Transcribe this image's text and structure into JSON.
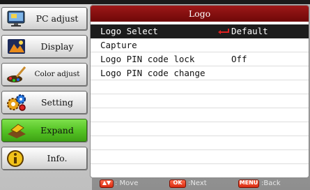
{
  "sidebar": {
    "items": [
      {
        "label": "PC adjust",
        "icon": "monitor-icon",
        "active": false
      },
      {
        "label": "Display",
        "icon": "display-icon",
        "active": false
      },
      {
        "label": "Color adjust",
        "icon": "color-brush-icon",
        "active": false
      },
      {
        "label": "Setting",
        "icon": "gears-icon",
        "active": false
      },
      {
        "label": "Expand",
        "icon": "expand-icon",
        "active": true
      },
      {
        "label": "Info.",
        "icon": "info-icon",
        "active": false
      }
    ]
  },
  "menu": {
    "title": "Logo",
    "rows": [
      {
        "label": "Logo Select",
        "value": "Default",
        "selected": true
      },
      {
        "label": "Capture",
        "value": ""
      },
      {
        "label": "Logo PIN code lock",
        "value": "Off"
      },
      {
        "label": "Logo PIN code change",
        "value": ""
      },
      {
        "label": "",
        "value": ""
      },
      {
        "label": "",
        "value": ""
      },
      {
        "label": "",
        "value": ""
      },
      {
        "label": "",
        "value": ""
      },
      {
        "label": "",
        "value": ""
      },
      {
        "label": "",
        "value": ""
      },
      {
        "label": "",
        "value": ""
      }
    ]
  },
  "footer": {
    "move_key": "▲▼",
    "move_label": ": Move",
    "ok_key": "OK",
    "ok_label": ":Next",
    "menu_key": "MENU",
    "menu_label": ":Back"
  },
  "colors": {
    "title_bar": "#8a1010",
    "selected_row": "#1c1c1c",
    "active_sidebar": "#56c426",
    "enter_arrow": "#e02020"
  }
}
